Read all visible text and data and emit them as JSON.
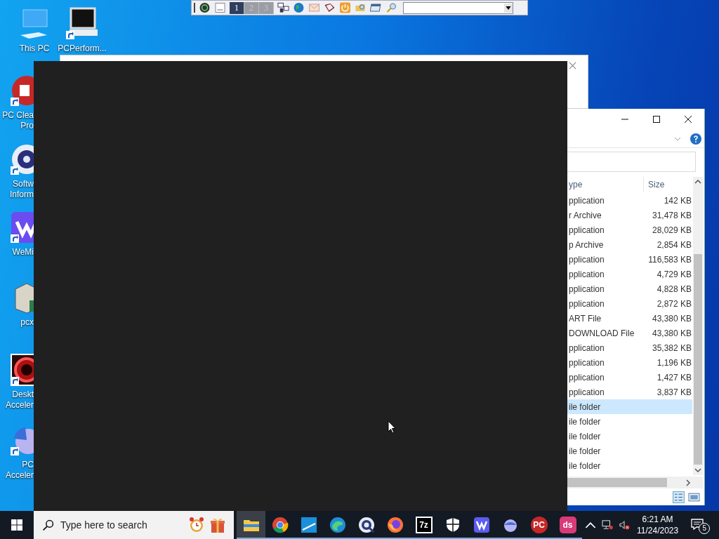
{
  "toolbar": {
    "desktops": [
      {
        "label": "1",
        "selected": true
      },
      {
        "label": "2",
        "selected": false
      },
      {
        "label": "3",
        "selected": false
      }
    ]
  },
  "desktop_icons": [
    {
      "kind": "monitor",
      "lines": [
        "This PC"
      ],
      "shortcut": false
    },
    {
      "kind": "laptop",
      "lines": [
        "PCPerform..."
      ],
      "shortcut": true
    },
    {
      "kind": "pc-red",
      "lines": [
        "PC Clea",
        "Pro"
      ],
      "shortcut": true
    },
    {
      "kind": "disc",
      "lines": [
        "Softw",
        "Inform"
      ],
      "shortcut": true
    },
    {
      "kind": "purple",
      "lines": [
        "WeMi"
      ],
      "shortcut": true
    },
    {
      "kind": "server",
      "lines": [
        "pcx"
      ],
      "shortcut": false
    },
    {
      "kind": "ring",
      "lines": [
        "Deskt",
        "Acceler"
      ],
      "shortcut": true
    },
    {
      "kind": "pie",
      "lines": [
        "PC",
        "Acceler"
      ],
      "shortcut": true
    }
  ],
  "explorer": {
    "columns": [
      "ype",
      "Size"
    ],
    "rows": [
      {
        "type": "pplication",
        "size": "142 KB",
        "selected": false
      },
      {
        "type": "r Archive",
        "size": "31,478 KB",
        "selected": false
      },
      {
        "type": "pplication",
        "size": "28,029 KB",
        "selected": false
      },
      {
        "type": "p Archive",
        "size": "2,854 KB",
        "selected": false
      },
      {
        "type": "pplication",
        "size": "116,583 KB",
        "selected": false
      },
      {
        "type": "pplication",
        "size": "4,729 KB",
        "selected": false
      },
      {
        "type": "pplication",
        "size": "4,828 KB",
        "selected": false
      },
      {
        "type": "pplication",
        "size": "2,872 KB",
        "selected": false
      },
      {
        "type": "ART File",
        "size": "43,380 KB",
        "selected": false
      },
      {
        "type": "DOWNLOAD File",
        "size": "43,380 KB",
        "selected": false
      },
      {
        "type": "pplication",
        "size": "35,382 KB",
        "selected": false
      },
      {
        "type": "pplication",
        "size": "1,196 KB",
        "selected": false
      },
      {
        "type": "pplication",
        "size": "1,427 KB",
        "selected": false
      },
      {
        "type": "pplication",
        "size": "3,837 KB",
        "selected": false
      },
      {
        "type": "ile folder",
        "selected": true
      },
      {
        "type": "ile folder",
        "selected": false
      },
      {
        "type": "ile folder",
        "selected": false
      },
      {
        "type": "ile folder",
        "selected": false
      },
      {
        "type": "ile folder",
        "selected": false
      }
    ]
  },
  "taskbar": {
    "search": {
      "placeholder": "Type here to search"
    },
    "apps": [
      {
        "kind": "folder",
        "selected": true
      },
      {
        "kind": "chrome",
        "selected": false
      },
      {
        "kind": "blue-app",
        "selected": false
      },
      {
        "kind": "edge",
        "selected": false
      },
      {
        "kind": "q",
        "selected": false
      },
      {
        "kind": "firefox",
        "selected": false
      },
      {
        "kind": "label-dark",
        "label": "7z",
        "selected": false
      },
      {
        "kind": "shield",
        "selected": false
      },
      {
        "kind": "w",
        "selected": false
      },
      {
        "kind": "ball",
        "selected": false
      },
      {
        "kind": "label-red",
        "label": "PC",
        "selected": false
      },
      {
        "kind": "label-pink",
        "label": "ds",
        "selected": false
      }
    ],
    "time": "6:21 AM",
    "date": "11/24/2023",
    "notifications": "5"
  }
}
